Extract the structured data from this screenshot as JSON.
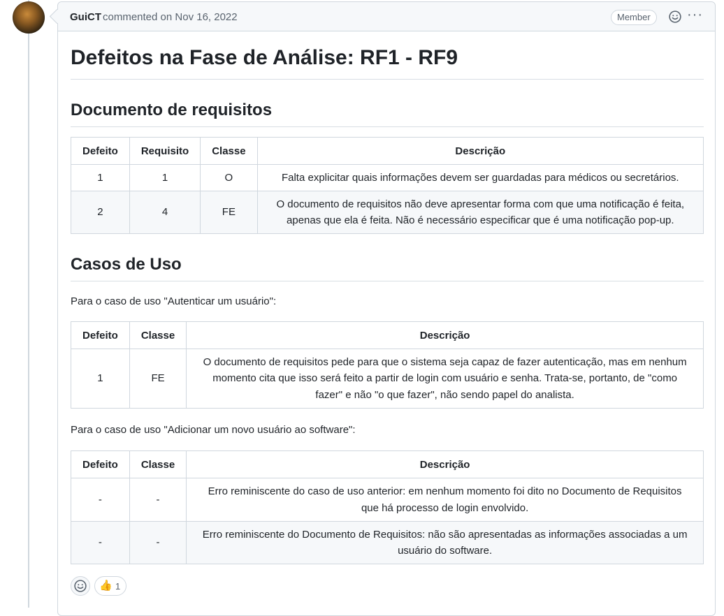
{
  "comment": {
    "author": "GuiCT",
    "action": "commented on Nov 16, 2022",
    "badge": "Member"
  },
  "body": {
    "title": "Defeitos na Fase de Análise: RF1 - RF9",
    "section1": {
      "heading": "Documento de requisitos",
      "headers": [
        "Defeito",
        "Requisito",
        "Classe",
        "Descrição"
      ],
      "rows": [
        [
          "1",
          "1",
          "O",
          "Falta explicitar quais informações devem ser guardadas para médicos ou secretários."
        ],
        [
          "2",
          "4",
          "FE",
          "O documento de requisitos não deve apresentar forma com que uma notificação é feita, apenas que ela é feita. Não é necessário especificar que é uma notificação pop-up."
        ]
      ]
    },
    "section2": {
      "heading": "Casos de Uso",
      "case1_intro": "Para o caso de uso \"Autenticar um usuário\":",
      "case1_headers": [
        "Defeito",
        "Classe",
        "Descrição"
      ],
      "case1_rows": [
        [
          "1",
          "FE",
          "O documento de requisitos pede para que o sistema seja capaz de fazer autenticação, mas em nenhum momento cita que isso será feito a partir de login com usuário e senha. Trata-se, portanto, de \"como fazer\" e não \"o que fazer\", não sendo papel do analista."
        ]
      ],
      "case2_intro": "Para o caso de uso \"Adicionar um novo usuário ao software\":",
      "case2_headers": [
        "Defeito",
        "Classe",
        "Descrição"
      ],
      "case2_rows": [
        [
          "-",
          "-",
          "Erro reminiscente do caso de uso anterior: em nenhum momento foi dito no Documento de Requisitos que há processo de login envolvido."
        ],
        [
          "-",
          "-",
          "Erro reminiscente do Documento de Requisitos: não são apresentadas as informações associadas a um usuário do software."
        ]
      ]
    }
  },
  "reactions": {
    "thumbs_up_icon": "thumbs-up",
    "thumbs_up_count": "1"
  }
}
